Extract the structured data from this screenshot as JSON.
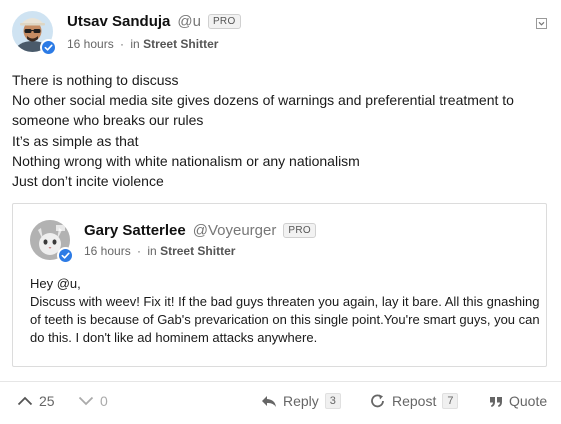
{
  "post": {
    "author": {
      "display_name": "Utsav Sanduja",
      "handle": "@u",
      "badge": "PRO",
      "avatar_icon": "avatar-sunglasses",
      "verified": true
    },
    "meta": {
      "time": "16 hours",
      "separator": "·",
      "in_label": "in",
      "group": "Street Shitter"
    },
    "body_lines": [
      "There is nothing to discuss",
      "No other social media site gives dozens of warnings and preferential treatment to someone who breaks our rules",
      "It’s as simple as that",
      "Nothing wrong with white nationalism or any nationalism",
      "Just don’t incite violence"
    ],
    "quoted": {
      "author": {
        "display_name": "Gary Satterlee",
        "handle": "@Voyeurger",
        "badge": "PRO",
        "avatar_icon": "avatar-cat",
        "verified": true
      },
      "meta": {
        "time": "16 hours",
        "separator": "·",
        "in_label": "in",
        "group": "Street Shitter"
      },
      "body_lines": [
        "Hey @u,",
        "Discuss with weev! Fix it! If the bad guys threaten you again, lay it bare. All this gnashing of teeth is because of Gab's prevarication on this single point.You're smart guys, you can do this. I don't like ad hominem attacks anywhere."
      ]
    }
  },
  "actions": {
    "upvote": {
      "icon": "chevron-up-icon",
      "count": "25"
    },
    "downvote": {
      "icon": "chevron-down-icon",
      "count": "0"
    },
    "reply": {
      "icon": "reply-icon",
      "label": "Reply",
      "count": "3"
    },
    "repost": {
      "icon": "repost-icon",
      "label": "Repost",
      "count": "7"
    },
    "quote": {
      "icon": "quote-icon",
      "label": "Quote"
    }
  },
  "colors": {
    "verified_blue": "#2c7be5",
    "muted_text": "#666666",
    "border": "#dcdcdc"
  }
}
